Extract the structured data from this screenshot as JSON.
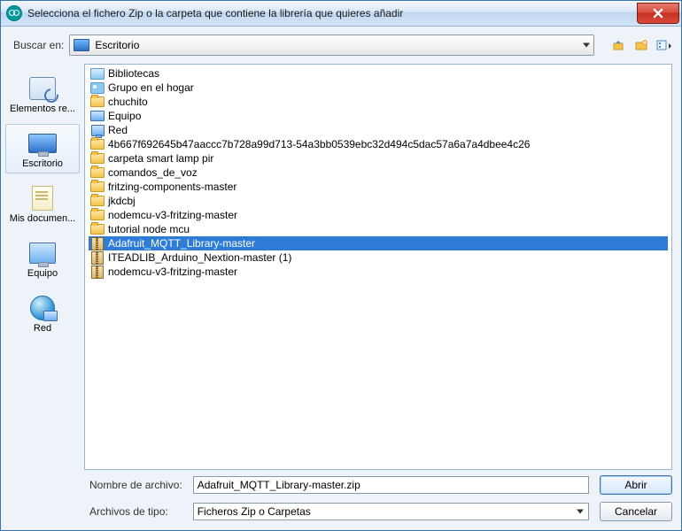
{
  "title": "Selecciona el fichero Zip o la carpeta que contiene la librería que quieres añadir",
  "toolbar": {
    "look_in_label": "Buscar en:",
    "look_in_value": "Escritorio"
  },
  "places": [
    {
      "label": "Elementos re...",
      "icon": "recent"
    },
    {
      "label": "Escritorio",
      "icon": "monitor",
      "selected": true
    },
    {
      "label": "Mis documen...",
      "icon": "docs"
    },
    {
      "label": "Equipo",
      "icon": "computer"
    },
    {
      "label": "Red",
      "icon": "net"
    }
  ],
  "files": [
    {
      "name": "Bibliotecas",
      "icon": "lib"
    },
    {
      "name": "Grupo en el hogar",
      "icon": "group"
    },
    {
      "name": "chuchito",
      "icon": "folder"
    },
    {
      "name": "Equipo",
      "icon": "computer"
    },
    {
      "name": "Red",
      "icon": "network"
    },
    {
      "name": "4b667f692645b47aaccc7b728a99d713-54a3bb0539ebc32d494c5dac57a6a7a4dbee4c26",
      "icon": "folder"
    },
    {
      "name": "carpeta smart lamp pir",
      "icon": "folder"
    },
    {
      "name": "comandos_de_voz",
      "icon": "folder"
    },
    {
      "name": "fritzing-components-master",
      "icon": "folder"
    },
    {
      "name": "jkdcbj",
      "icon": "folder"
    },
    {
      "name": "nodemcu-v3-fritzing-master",
      "icon": "folder"
    },
    {
      "name": "tutorial node mcu",
      "icon": "folder"
    },
    {
      "name": "Adafruit_MQTT_Library-master",
      "icon": "zip",
      "selected": true
    },
    {
      "name": "ITEADLIB_Arduino_Nextion-master (1)",
      "icon": "zip"
    },
    {
      "name": "nodemcu-v3-fritzing-master",
      "icon": "zip"
    }
  ],
  "bottom": {
    "filename_label": "Nombre de archivo:",
    "filename_value": "Adafruit_MQTT_Library-master.zip",
    "filetype_label": "Archivos de tipo:",
    "filetype_value": "Ficheros Zip o Carpetas",
    "open_label": "Abrir",
    "cancel_label": "Cancelar"
  }
}
